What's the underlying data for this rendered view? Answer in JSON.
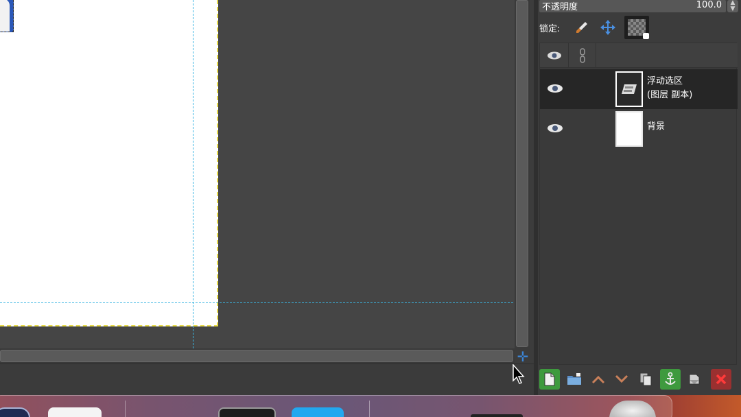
{
  "layers_panel": {
    "opacity_label": "不透明度",
    "opacity_value": "100.0",
    "lock_label": "锁定:",
    "lock_icons": [
      "paintbrush-icon",
      "move-arrows-icon",
      "checker-lock-icon"
    ],
    "layers": [
      {
        "name_line1": "浮动选区",
        "name_line2": "(图层 副本)",
        "visible": true,
        "selected": true
      },
      {
        "name_line1": "背景",
        "visible": true,
        "selected": false
      }
    ],
    "toolbar_icons": [
      "new-layer-icon",
      "new-layer-group-icon",
      "raise-layer-icon",
      "lower-layer-icon",
      "duplicate-layer-icon",
      "anchor-layer-icon",
      "merge-layer-icon",
      "delete-layer-icon"
    ]
  },
  "colors": {
    "guide": "#3bb6e3",
    "selection_border": "#e8dc4a",
    "panel_bg": "#3c3c3c",
    "accent_green": "#3e9a3e",
    "accent_red": "#9a3030"
  }
}
